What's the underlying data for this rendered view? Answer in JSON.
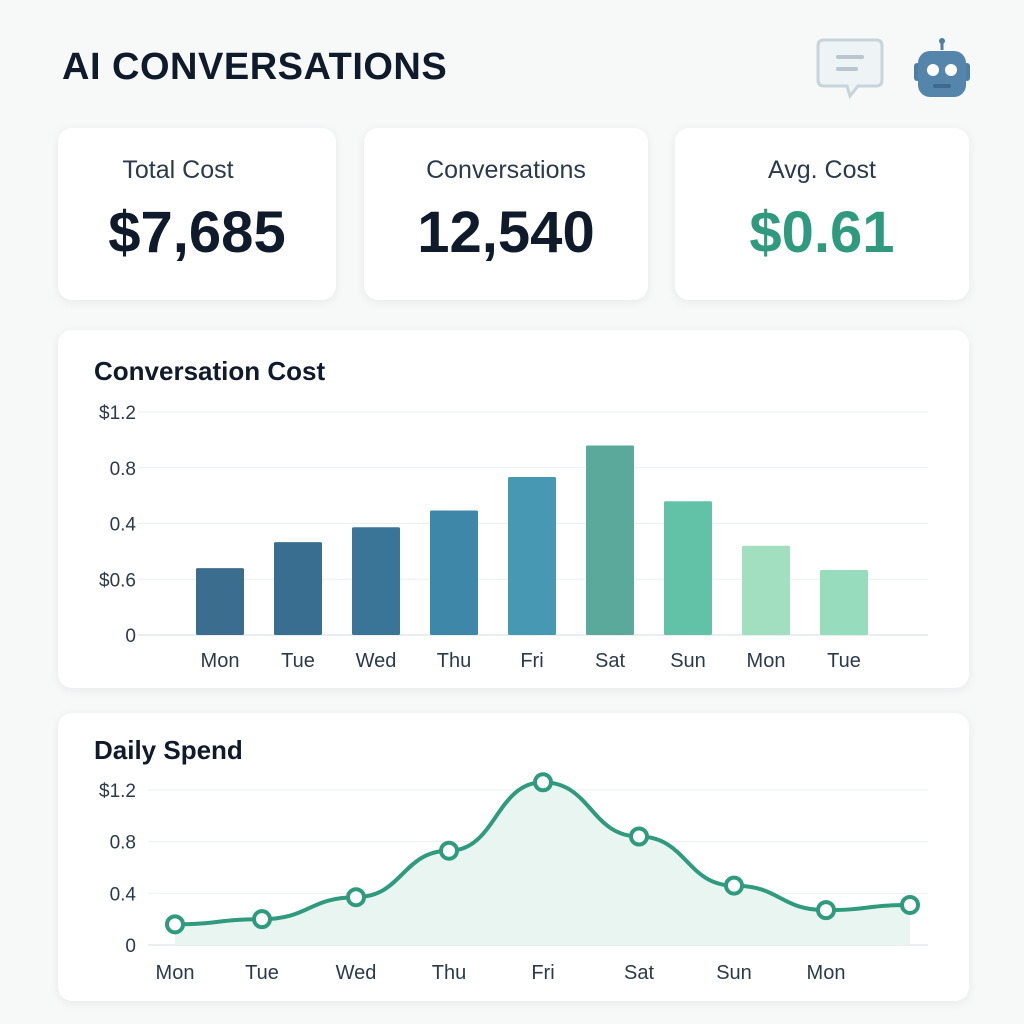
{
  "header": {
    "title": "AI CONVERSATIONS",
    "icons": [
      "chat-icon",
      "robot-icon"
    ]
  },
  "kpis": [
    {
      "label": "Total Cost",
      "value": "$7,685",
      "accent": false
    },
    {
      "label": "Conversations",
      "value": "12,540",
      "accent": false
    },
    {
      "label": "Avg. Cost",
      "value": "$0.61",
      "accent": true
    }
  ],
  "colors": {
    "accent": "#2f9a7e",
    "bars": [
      "#3b6d8e",
      "#3a6e90",
      "#3a7496",
      "#3f87a8",
      "#4799b3",
      "#5aa99b",
      "#62c2a8",
      "#a2dfc0",
      "#96dcbd"
    ],
    "line": "#2f9a7e",
    "area": "#e8f5f0"
  },
  "chart_data": [
    {
      "type": "bar",
      "title": "Conversation Cost",
      "categories": [
        "Mon",
        "Tue",
        "Wed",
        "Thu",
        "Fri",
        "Sat",
        "Sun",
        "Mon",
        "Tue"
      ],
      "values": [
        0.36,
        0.5,
        0.58,
        0.67,
        0.85,
        1.02,
        0.72,
        0.48,
        0.35
      ],
      "ytick_labels": [
        "0",
        "$0.6",
        "0.4",
        "0.8",
        "$1.2"
      ],
      "ylim": [
        0,
        1.2
      ],
      "grid": true
    },
    {
      "type": "area",
      "title": "Daily Spend",
      "categories": [
        "Mon",
        "Tue",
        "Wed",
        "Thu",
        "Fri",
        "Sat",
        "Sun",
        "Mon"
      ],
      "values": [
        0.16,
        0.2,
        0.37,
        0.73,
        1.26,
        0.84,
        0.46,
        0.27,
        0.31
      ],
      "ytick_labels": [
        "0",
        "0.4",
        "0.8",
        "$1.2"
      ],
      "ylim": [
        0,
        1.2
      ],
      "grid": true
    }
  ]
}
